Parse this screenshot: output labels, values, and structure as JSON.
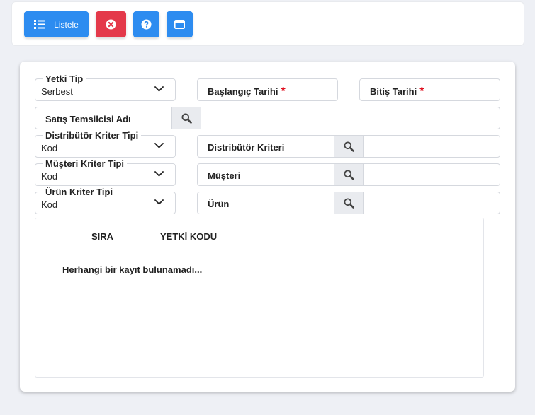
{
  "toolbar": {
    "list_label": "Listele",
    "colors": {
      "primary": "#2d8cf0",
      "danger": "#e4394a"
    }
  },
  "form": {
    "yetki_tip": {
      "label": "Yetki Tip",
      "value": "Serbest"
    },
    "baslangic_tarihi": {
      "label": "Başlangıç Tarihi",
      "required_mark": "*"
    },
    "bitis_tarihi": {
      "label": "Bitiş Tarihi",
      "required_mark": "*"
    },
    "satis_temsilcisi": {
      "label": "Satış Temsilcisi Adı",
      "value": ""
    },
    "distributor_kriter_tipi": {
      "label": "Distribütör Kriter Tipi",
      "value": "Kod"
    },
    "distributor_kriteri": {
      "label": "Distribütör Kriteri",
      "value": ""
    },
    "musteri_kriter_tipi": {
      "label": "Müşteri Kriter Tipi",
      "value": "Kod"
    },
    "musteri": {
      "label": "Müşteri",
      "value": ""
    },
    "urun_kriter_tipi": {
      "label": "Ürün Kriter Tipi",
      "value": "Kod"
    },
    "urun": {
      "label": "Ürün",
      "value": ""
    }
  },
  "grid": {
    "columns": [
      "SIRA",
      "YETKİ KODU"
    ],
    "empty_message": "Herhangi bir kayıt bulunamadı..."
  }
}
